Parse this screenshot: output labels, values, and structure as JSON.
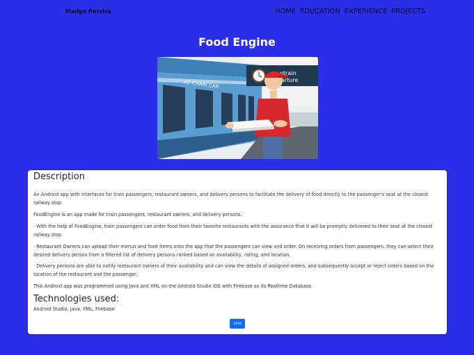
{
  "header": {
    "brand": "Madge Pereira",
    "nav": [
      "HOME",
      "EDUCATION",
      "EXPERIENCE",
      "PROJECTS"
    ]
  },
  "project": {
    "title": "Food Engine",
    "image": {
      "sign_text": "AC CHAIR CAR",
      "board_line1": "otrain",
      "board_line2": "arture"
    },
    "description_heading": "Description",
    "paragraphs": [
      "An Android app with interfaces for train passengers, restaurant owners, and delivery persons to facilitate the delivery of food directly to the passenger's seat at the closest railway stop.",
      "FoodEngine is an app made for train passengers, restaurant owners, and delivery persons.",
      "· With the help of FoodEngine, train passengers can order food from their favorite restaurants with the assurance that it will be promptly delivered to their seat at the closest railway stop.",
      "· Restaurant Owners can upload their menus and food items onto the app that the passengers can view and order. On receiving orders from passengers, they can select their desired delivery person from a filtered list of delivery persons ranked based on availability, rating, and location.",
      "· Delivery persons are able to notify restaurant owners of their availability and can view the details of assigned orders, and subsequently accept or reject orders based on the location of the restaurant and the passenger.",
      "This Android app was programmed using Java and XML on the Android Studio IDE with Firebase as its Realtime Database."
    ],
    "tech_heading": "Technologies used:",
    "tech_list": "Android Studio, Java, XML, Firebase",
    "link_label": "Link"
  },
  "colors": {
    "background": "#2a2ee6",
    "card": "#ffffff",
    "button": "#0d6efd"
  }
}
